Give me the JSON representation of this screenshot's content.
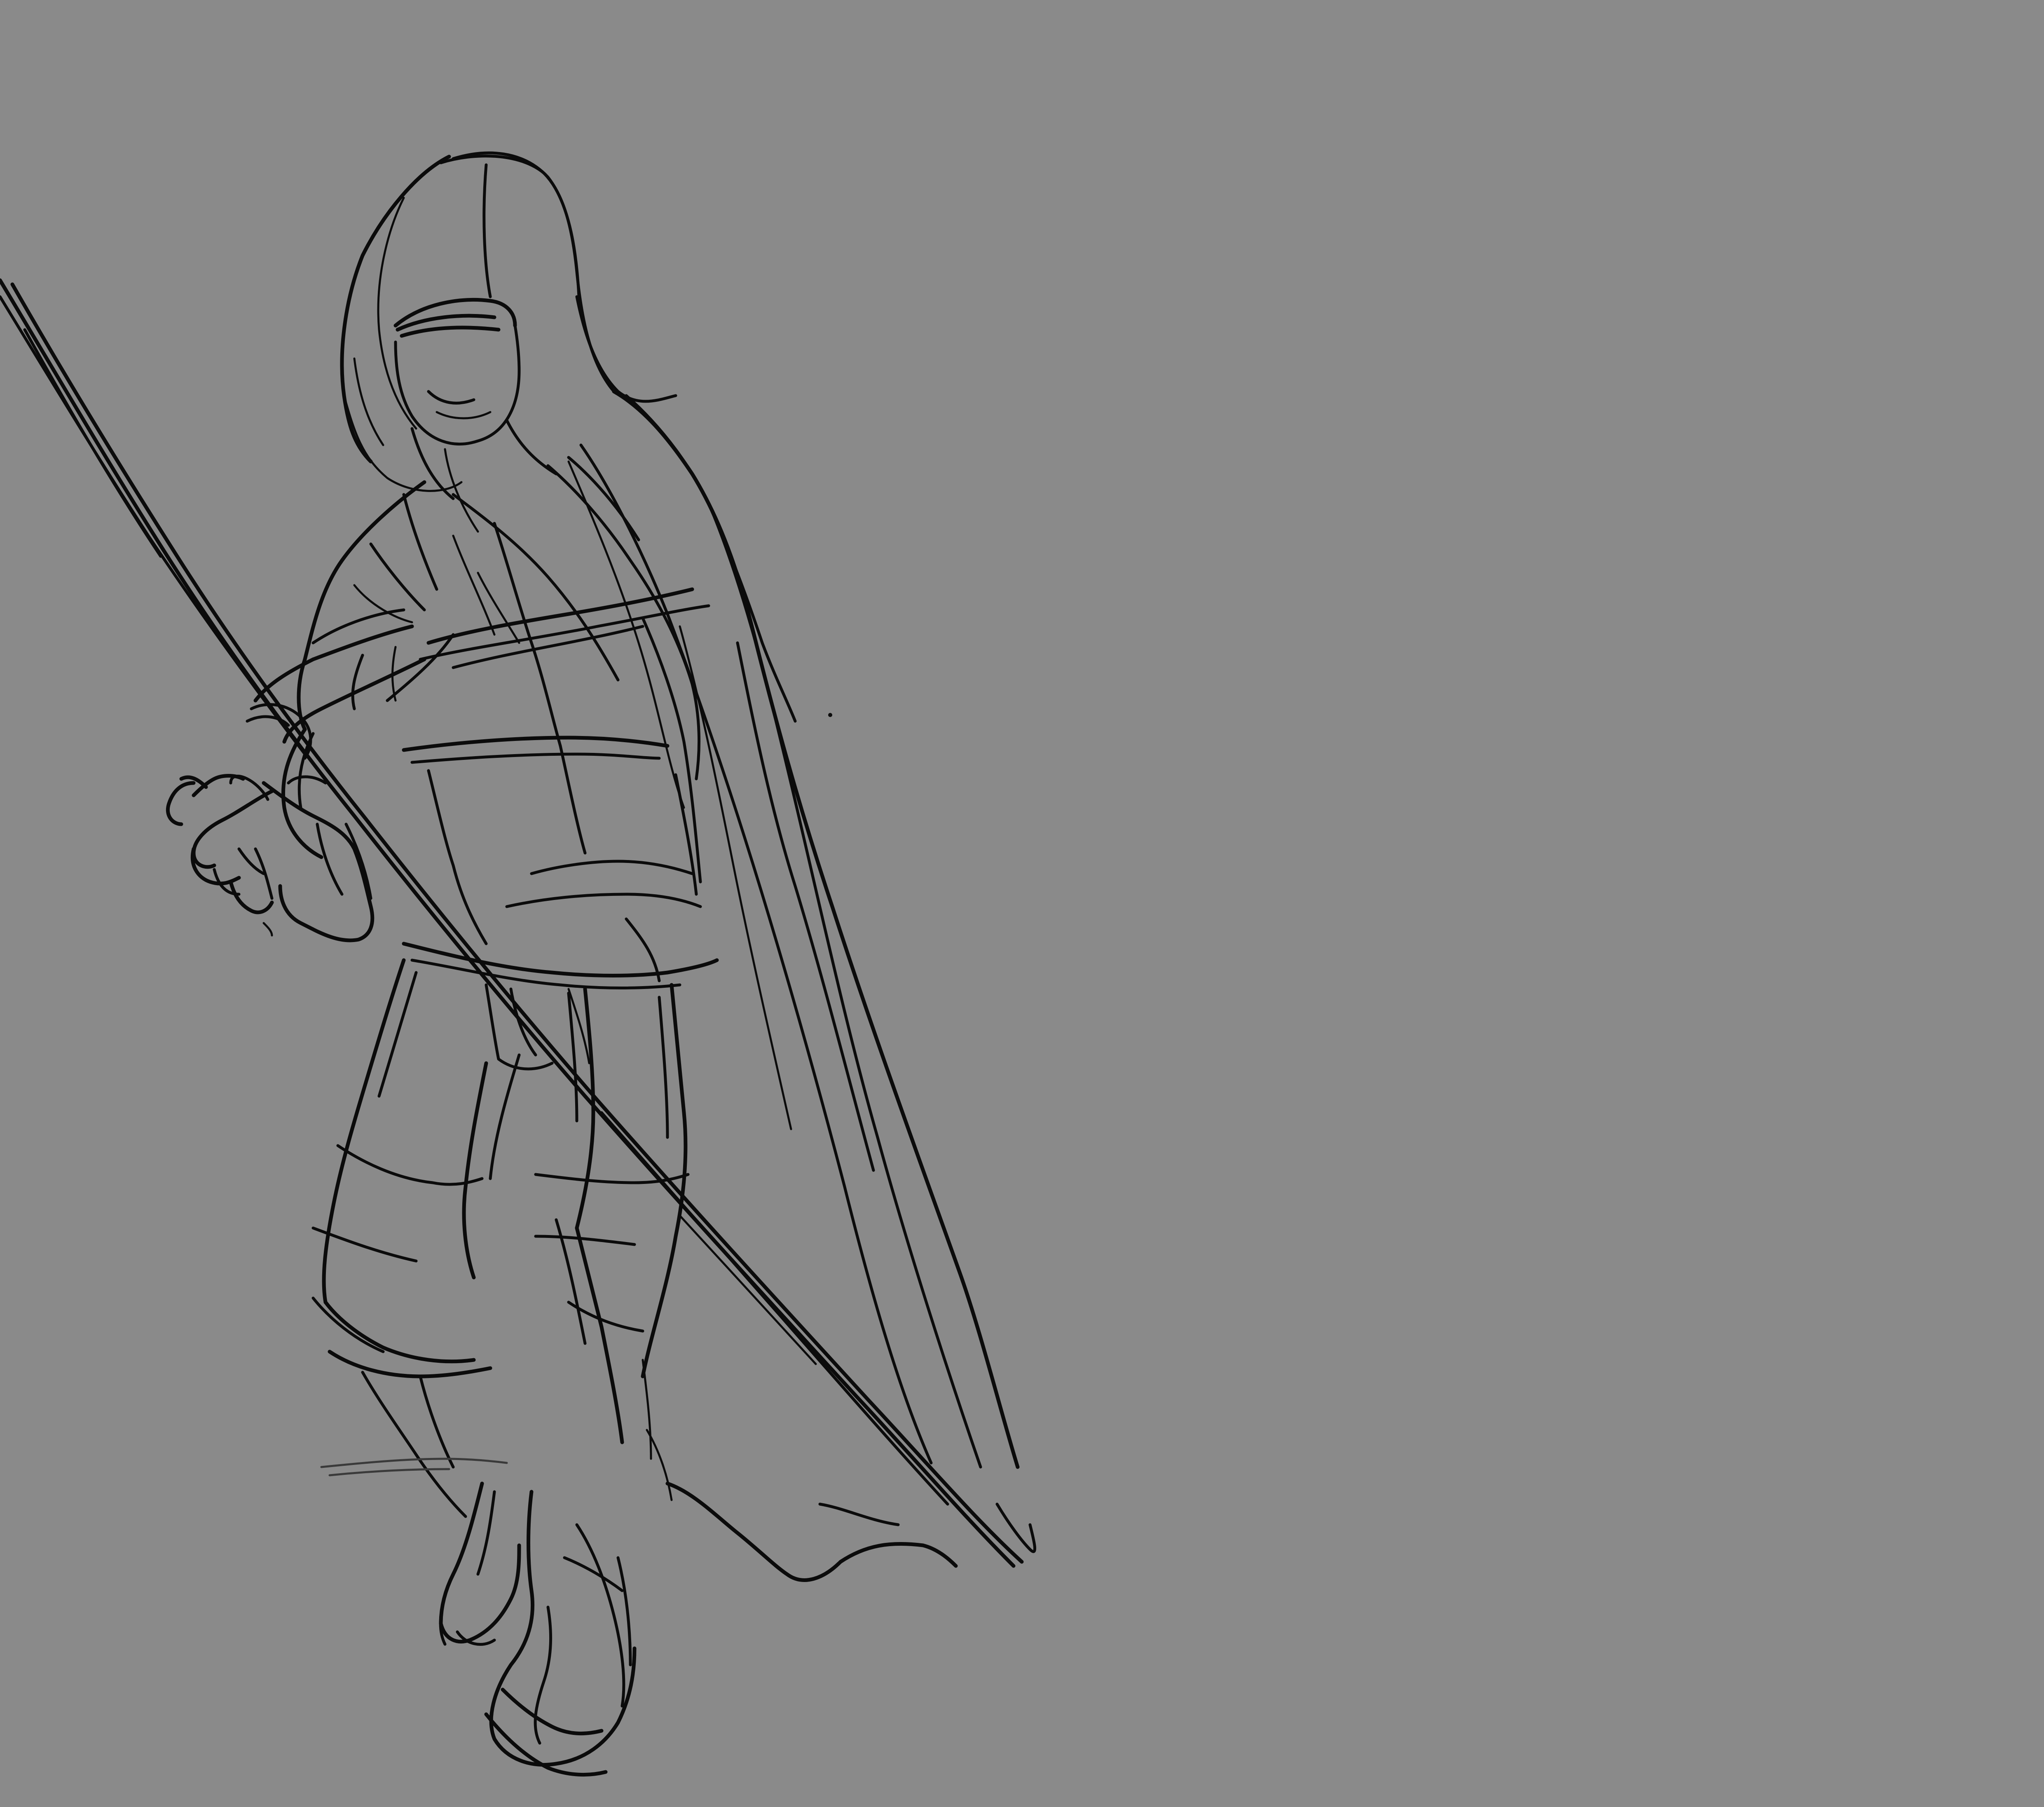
{
  "canvas": {
    "background_color": "#8a8a8a",
    "line_color": "#0b0b0b"
  },
  "artwork": {
    "subject": "",
    "elements": [
      "hood",
      "mask",
      "cloak",
      "arm",
      "hand",
      "staff",
      "belt",
      "legs",
      "boots"
    ]
  }
}
